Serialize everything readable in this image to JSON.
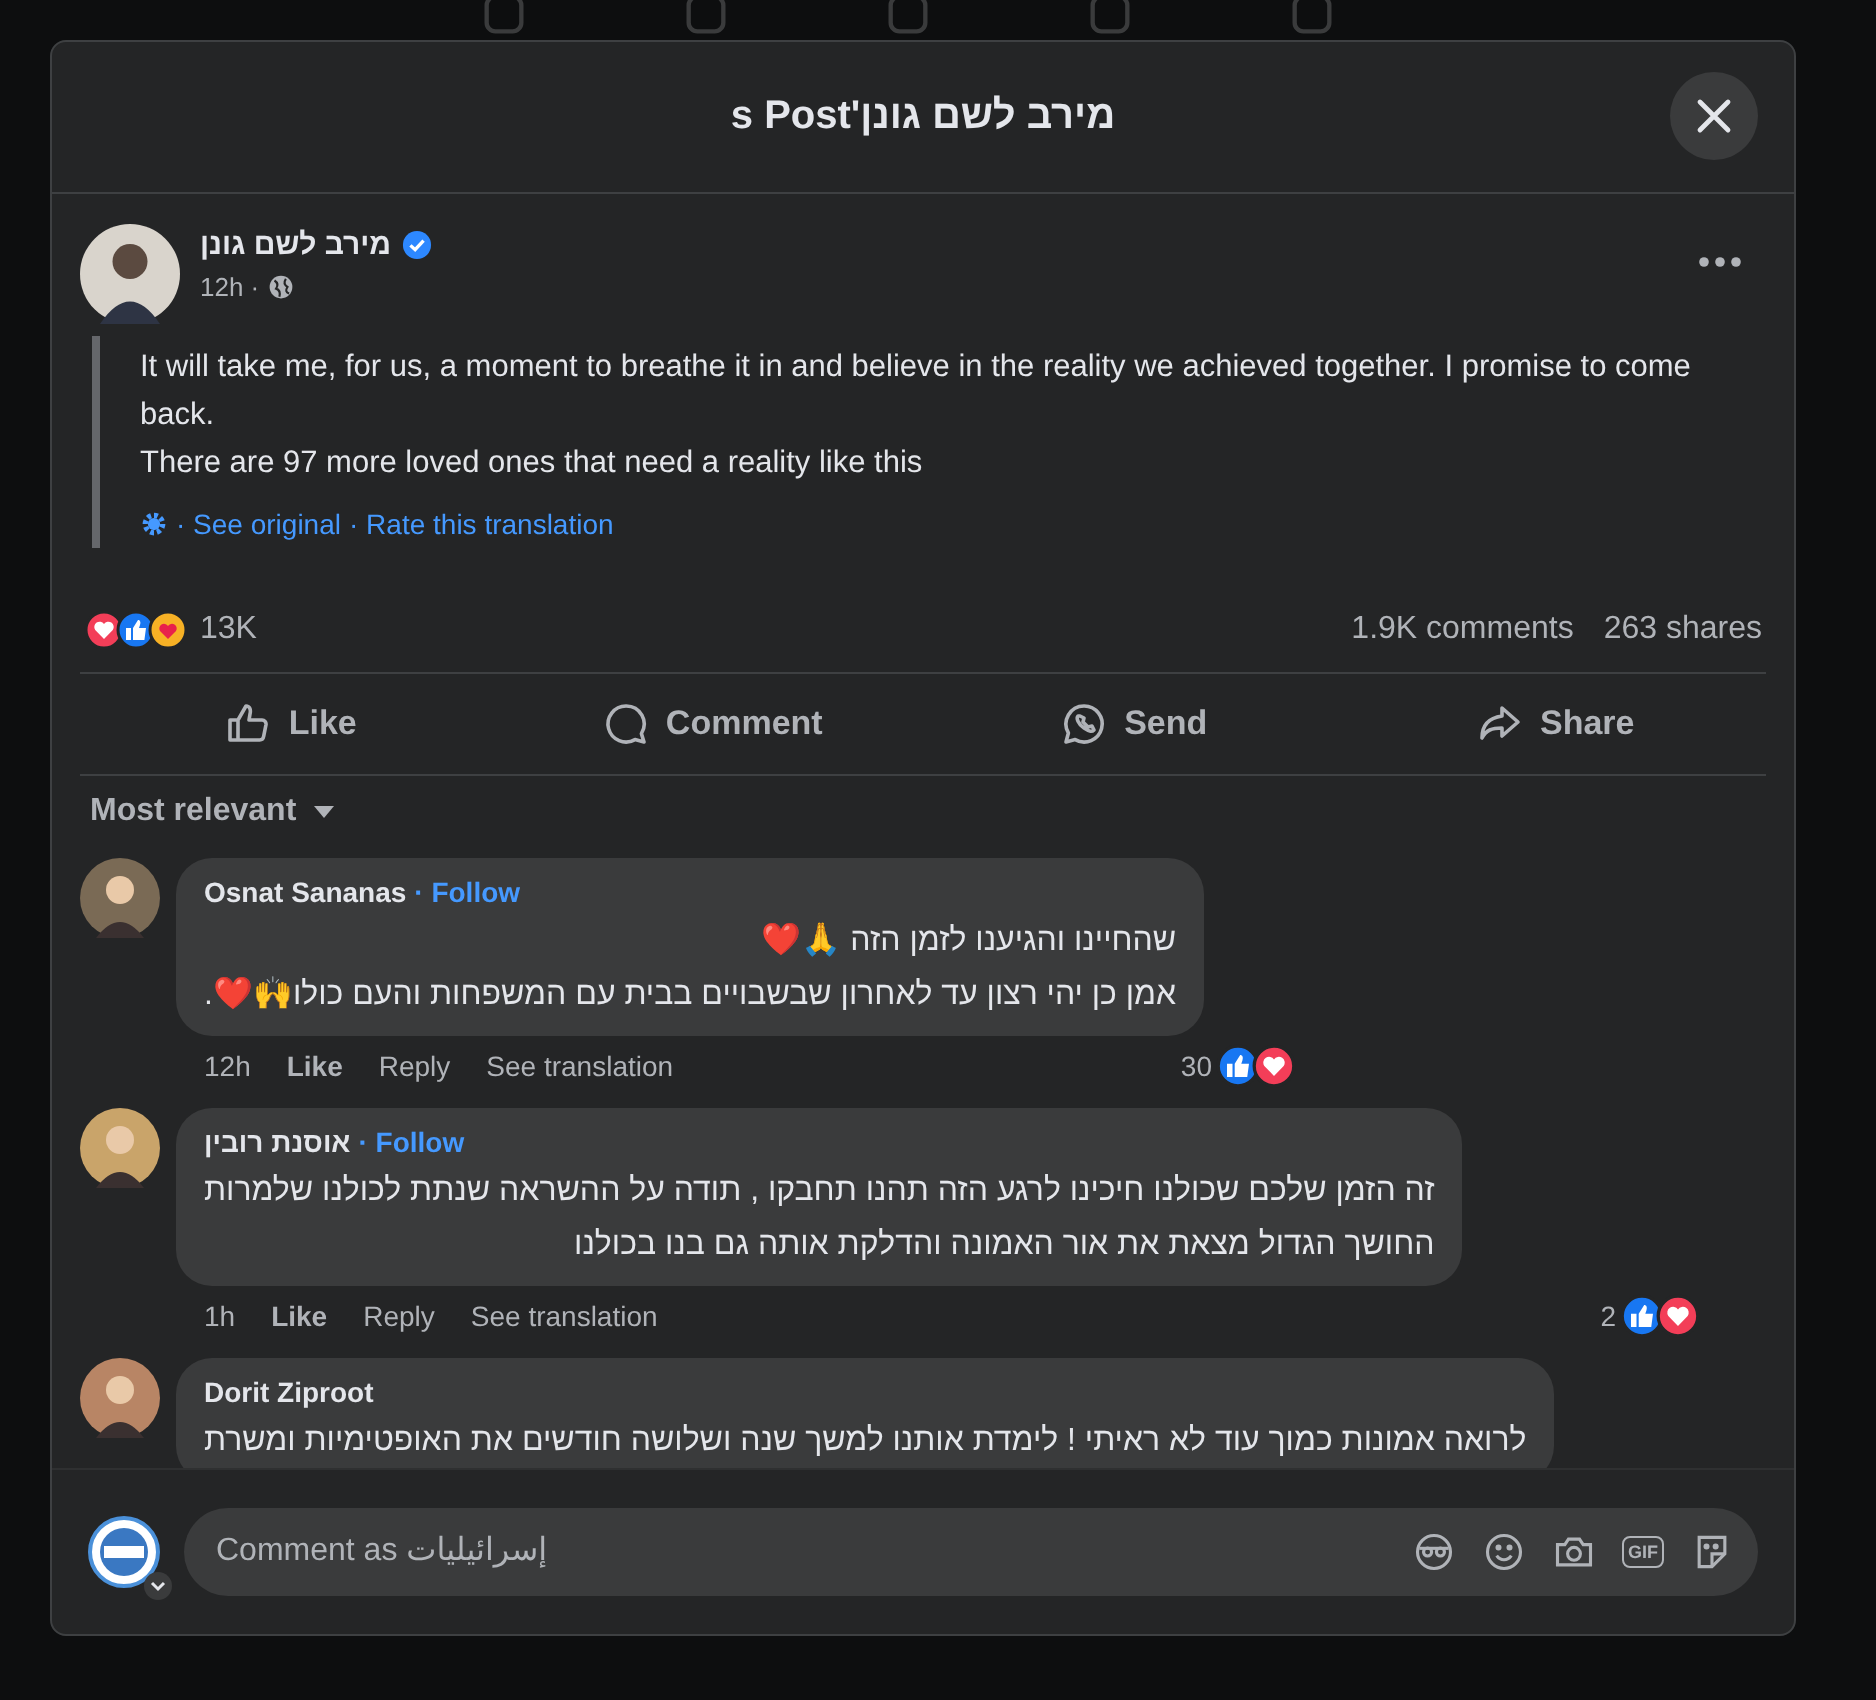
{
  "dialog": {
    "title": "מירב לשם גונן's Post"
  },
  "post": {
    "author": "מירב לשם גונן",
    "verified": true,
    "time": "12h ·",
    "text_lines": [
      "It will take me, for us, a moment to breathe it in and believe in the reality we achieved together. I promise to come back.",
      "There are 97 more loved ones that need a reality like this"
    ],
    "see_original": "· See original",
    "rate_translation": "· Rate this translation"
  },
  "stats": {
    "reactions": [
      {
        "kind": "love"
      },
      {
        "kind": "like"
      },
      {
        "kind": "care"
      }
    ],
    "reaction_count": "13K",
    "comments": "1.9K comments",
    "shares": "263 shares"
  },
  "actions": [
    {
      "kind": "like",
      "label": "Like"
    },
    {
      "kind": "comment",
      "label": "Comment"
    },
    {
      "kind": "send",
      "label": "Send"
    },
    {
      "kind": "share",
      "label": "Share"
    }
  ],
  "sort": {
    "label": "Most relevant"
  },
  "comments": [
    {
      "author": "Osnat Sananas",
      "follow": "· Follow",
      "lines": [
        "שהחיינו והגיענו לזמן הזה 🙏❤️",
        "אמן כן יהי רצון עד לאחרון שבשבויים בבית עם המשפחות והעם כולו🙌❤️."
      ],
      "time": "12h",
      "like": "Like",
      "reply": "Reply",
      "see_translation": "See translation",
      "reaction_count": "30",
      "reactions": [
        {
          "kind": "like"
        },
        {
          "kind": "love"
        }
      ]
    },
    {
      "author": "אוסנת רובין",
      "follow": "· Follow",
      "lines": [
        "זה הזמן שלכם שכולנו חיכינו לרגע הזה תהנו תחבקו , תודה על ההשראה שנתת לכולנו שלמרות",
        "החושך הגדול מצאת את אור האמונה והדלקת אותה גם בנו בכולנו"
      ],
      "time": "1h",
      "like": "Like",
      "reply": "Reply",
      "see_translation": "See translation",
      "reaction_count": "2",
      "reactions": [
        {
          "kind": "like"
        },
        {
          "kind": "love"
        }
      ]
    },
    {
      "author": "Dorit Ziproot",
      "lines": [
        "לרואה אמונות כמוך עוד לא ראיתי ! לימדת אותנו למשך שנה ושלושה חודשים את האופטימיות ומשרת"
      ]
    }
  ],
  "composer": {
    "placeholder": "Comment as إسرائيليات",
    "gif": "GIF"
  }
}
